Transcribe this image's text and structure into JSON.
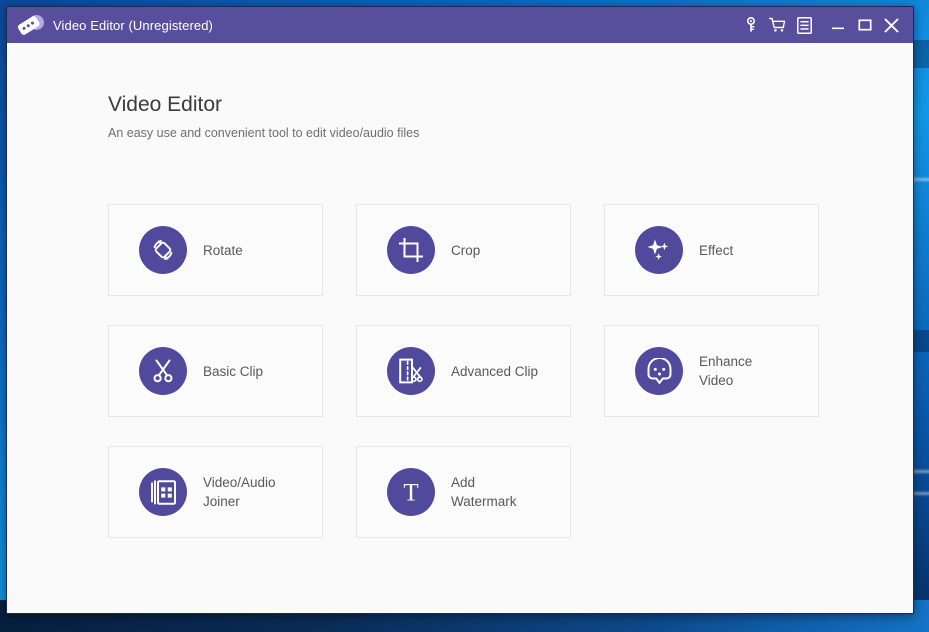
{
  "window": {
    "title": "Video Editor (Unregistered)",
    "logo_icon": "video-tape-logo-icon",
    "titlebar_color": "#574f9c",
    "titlebar_buttons": [
      {
        "name": "register-key-button",
        "icon": "key-icon",
        "tooltip": "Register"
      },
      {
        "name": "buy-cart-button",
        "icon": "shopping-cart-icon",
        "tooltip": "Buy"
      },
      {
        "name": "menu-button",
        "icon": "list-menu-icon",
        "tooltip": "Menu"
      },
      {
        "name": "minimize-button",
        "icon": "minimize-icon",
        "tooltip": "Minimize"
      },
      {
        "name": "maximize-button",
        "icon": "maximize-icon",
        "tooltip": "Maximize"
      },
      {
        "name": "close-button",
        "icon": "close-icon",
        "tooltip": "Close"
      }
    ]
  },
  "header": {
    "title": "Video Editor",
    "subtitle": "An easy use and convenient tool to edit video/audio files"
  },
  "theme": {
    "accent": "#514a9c",
    "titlebar": "#574f9c",
    "client_bg": "#fafafa",
    "card_bg": "#fbfbfb",
    "card_border": "#e6e6e6",
    "label_color": "#595959",
    "desktop_blue": "#0d6ec9"
  },
  "tools": [
    {
      "label": "Rotate",
      "icon": "rotate-icon"
    },
    {
      "label": "Crop",
      "icon": "crop-icon"
    },
    {
      "label": "Effect",
      "icon": "sparkle-effect-icon"
    },
    {
      "label": "Basic Clip",
      "icon": "scissors-icon"
    },
    {
      "label": "Advanced Clip",
      "icon": "frame-scissors-icon"
    },
    {
      "label": "Enhance\nVideo",
      "icon": "enhance-shield-icon"
    },
    {
      "label": "Video/Audio\nJoiner",
      "icon": "stacked-frames-icon"
    },
    {
      "label": "Add\nWatermark",
      "icon": "text-t-icon"
    }
  ]
}
